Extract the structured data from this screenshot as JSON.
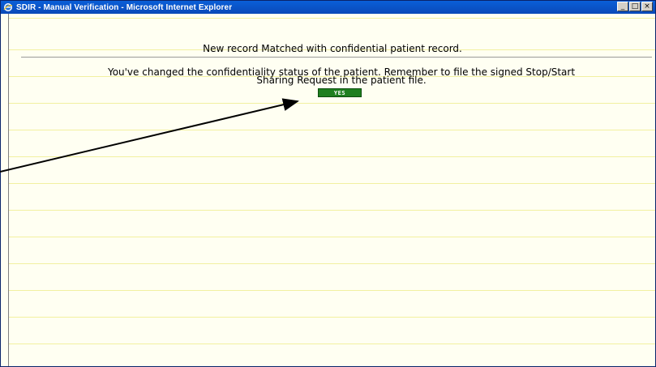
{
  "window": {
    "title": "SDIR - Manual Verification - Microsoft Internet Explorer",
    "controls": {
      "minimize": "_",
      "maximize": "□",
      "close": "×"
    }
  },
  "page": {
    "header_message": "New record Matched with confidential patient record.",
    "notice_line1": "You've changed the confidentiality status of the patient. Remember to file the signed Stop/Start",
    "notice_line2": "Sharing Request in the patient file.",
    "yes_label": "YES"
  },
  "icons": {
    "app_icon": "internet-explorer-icon",
    "annotation": "arrow-icon"
  },
  "colors": {
    "titlebar": "#0a49b8",
    "background": "#fffff2",
    "ruled_line": "#f2f0a0",
    "yes_button": "#1f7f1f",
    "arrow": "#000000"
  }
}
